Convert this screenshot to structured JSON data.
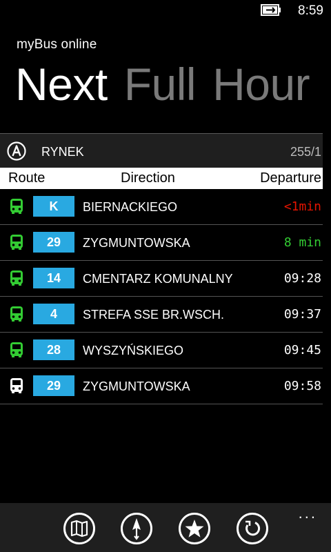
{
  "status": {
    "time": "8:59"
  },
  "app": {
    "title": "myBus online",
    "pivots": [
      {
        "label": "Next",
        "active": true
      },
      {
        "label": "Full",
        "active": false
      },
      {
        "label": "Hour",
        "active": false
      }
    ]
  },
  "stop": {
    "name": "RYNEK",
    "code": "255/1",
    "icon": "letter-a-circle-icon"
  },
  "table": {
    "headers": {
      "route": "Route",
      "direction": "Direction",
      "departure": "Departure"
    },
    "rows": [
      {
        "route": "K",
        "direction": "BIERNACKIEGO",
        "departure": "<1min",
        "departure_color": "#e51400",
        "icon_color": "#33cc33"
      },
      {
        "route": "29",
        "direction": "ZYGMUNTOWSKA",
        "departure": "8 min",
        "departure_color": "#33cc33",
        "icon_color": "#33cc33"
      },
      {
        "route": "14",
        "direction": "CMENTARZ KOMUNALNY",
        "departure": "09:28",
        "departure_color": "#ffffff",
        "icon_color": "#33cc33"
      },
      {
        "route": "4",
        "direction": "STREFA SSE BR.WSCH.",
        "departure": "09:37",
        "departure_color": "#ffffff",
        "icon_color": "#33cc33"
      },
      {
        "route": "28",
        "direction": "WYSZYŃSKIEGO",
        "departure": "09:45",
        "departure_color": "#ffffff",
        "icon_color": "#33cc33"
      },
      {
        "route": "29",
        "direction": "ZYGMUNTOWSKA",
        "departure": "09:58",
        "departure_color": "#ffffff",
        "icon_color": "#ffffff"
      }
    ]
  },
  "app_bar": {
    "buttons": [
      "map-icon",
      "compass-icon",
      "star-icon",
      "refresh-icon"
    ],
    "more": "..."
  },
  "colors": {
    "accent": "#29a9e1",
    "bus_green": "#33cc33",
    "alert_red": "#e51400"
  }
}
